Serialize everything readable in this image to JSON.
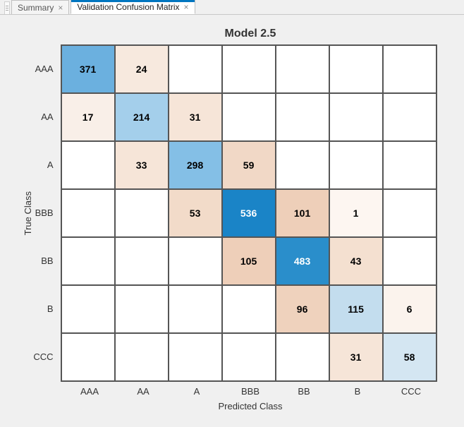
{
  "tabs": {
    "inactive_label": "Summary",
    "active_label": "Validation Confusion Matrix"
  },
  "chart_data": {
    "type": "heatmap",
    "title": "Model 2.5",
    "xlabel": "Predicted Class",
    "ylabel": "True Class",
    "row_categories": [
      "AAA",
      "AA",
      "A",
      "BBB",
      "BB",
      "B",
      "CCC"
    ],
    "col_categories": [
      "AAA",
      "AA",
      "A",
      "BBB",
      "BB",
      "B",
      "CCC"
    ],
    "values": [
      [
        371,
        24,
        null,
        null,
        null,
        null,
        null
      ],
      [
        17,
        214,
        31,
        null,
        null,
        null,
        null
      ],
      [
        null,
        33,
        298,
        59,
        null,
        null,
        null
      ],
      [
        null,
        null,
        53,
        536,
        101,
        1,
        null
      ],
      [
        null,
        null,
        null,
        105,
        483,
        43,
        null
      ],
      [
        null,
        null,
        null,
        null,
        96,
        115,
        6
      ],
      [
        null,
        null,
        null,
        null,
        null,
        31,
        58
      ]
    ],
    "cell_colors": [
      [
        "#6bb0df",
        "#f7e9de",
        "#ffffff",
        "#ffffff",
        "#ffffff",
        "#ffffff",
        "#ffffff"
      ],
      [
        "#f9efe8",
        "#a4cfeb",
        "#f6e5d8",
        "#ffffff",
        "#ffffff",
        "#ffffff",
        "#ffffff"
      ],
      [
        "#ffffff",
        "#f6e5d8",
        "#84bfe6",
        "#f1d8c6",
        "#ffffff",
        "#ffffff",
        "#ffffff"
      ],
      [
        "#ffffff",
        "#ffffff",
        "#f2dbc9",
        "#1a84c7",
        "#eecfb9",
        "#fdf6f1",
        "#ffffff"
      ],
      [
        "#ffffff",
        "#ffffff",
        "#ffffff",
        "#eecfb9",
        "#2a8ecb",
        "#f4e0d0",
        "#ffffff"
      ],
      [
        "#ffffff",
        "#ffffff",
        "#ffffff",
        "#ffffff",
        "#efd2bd",
        "#c3ddee",
        "#fbf3ed"
      ],
      [
        "#ffffff",
        "#ffffff",
        "#ffffff",
        "#ffffff",
        "#ffffff",
        "#f6e5d8",
        "#d4e6f2"
      ]
    ],
    "cell_text_color": [
      [
        "#000",
        "#000",
        "#000",
        "#000",
        "#000",
        "#000",
        "#000"
      ],
      [
        "#000",
        "#000",
        "#000",
        "#000",
        "#000",
        "#000",
        "#000"
      ],
      [
        "#000",
        "#000",
        "#000",
        "#000",
        "#000",
        "#000",
        "#000"
      ],
      [
        "#000",
        "#000",
        "#000",
        "#fff",
        "#000",
        "#000",
        "#000"
      ],
      [
        "#000",
        "#000",
        "#000",
        "#000",
        "#fff",
        "#000",
        "#000"
      ],
      [
        "#000",
        "#000",
        "#000",
        "#000",
        "#000",
        "#000",
        "#000"
      ],
      [
        "#000",
        "#000",
        "#000",
        "#000",
        "#000",
        "#000",
        "#000"
      ]
    ]
  }
}
